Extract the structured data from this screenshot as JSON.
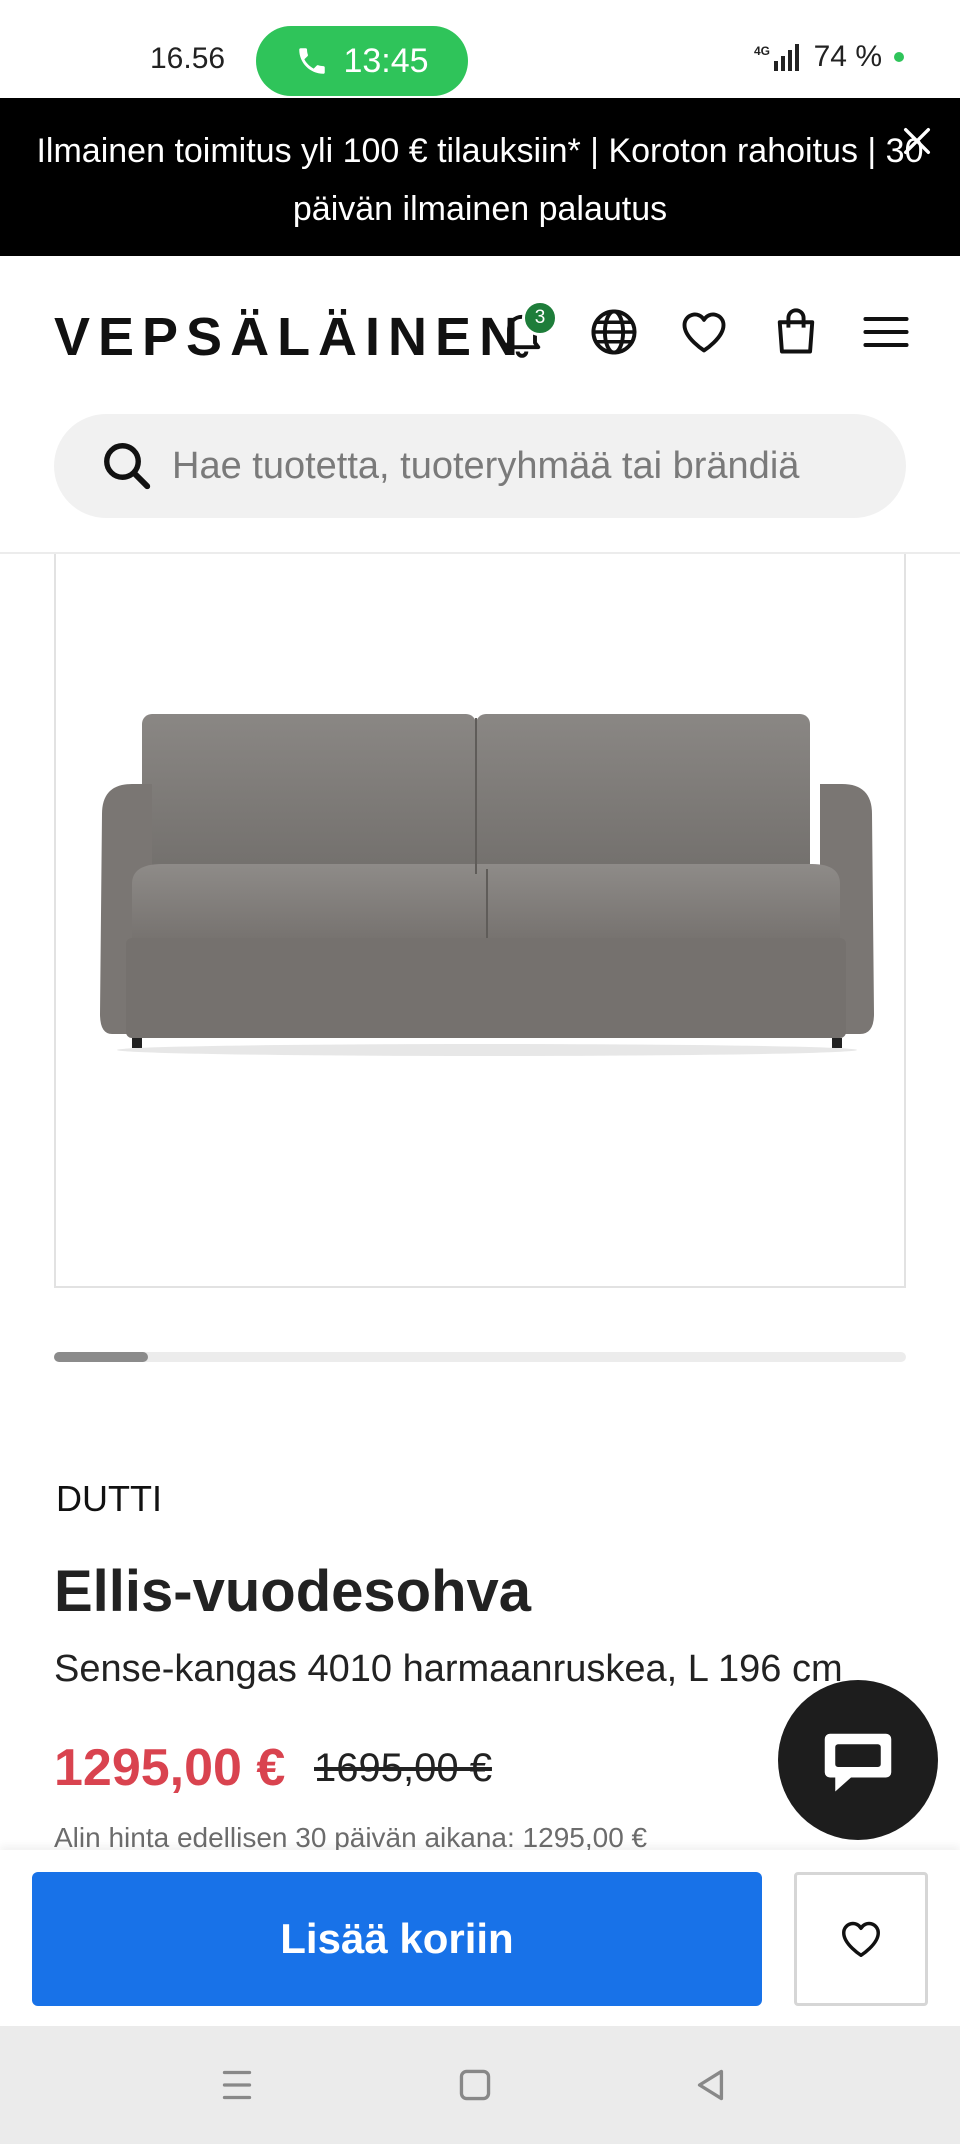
{
  "status_bar": {
    "time": "16.56",
    "call_timer": "13:45",
    "network": "4G",
    "battery": "74 %"
  },
  "promo": {
    "text": "Ilmainen toimitus yli 100 € tilauksiin* | Koroton rahoitus | 30 päivän ilmainen palautus"
  },
  "header": {
    "logo": "VEPSÄLÄINEN",
    "notification_count": "3",
    "icons": [
      "bell-icon",
      "globe-icon",
      "heart-icon",
      "shopping-bag-icon",
      "menu-icon"
    ]
  },
  "search": {
    "placeholder": "Hae tuotetta, tuoteryhmää tai brändiä"
  },
  "gallery": {
    "image_index": 1
  },
  "product": {
    "brand": "DUTTI",
    "title": "Ellis-vuodesohva",
    "subtitle": "Sense-kangas 4010 harmaanruskea, L 196 cm",
    "price": "1295,00 €",
    "old_price": "1695,00 €",
    "lowest_price_note": "Alin hinta edellisen 30 päivän aikana: 1295,00 €"
  },
  "actions": {
    "add_to_cart": "Lisää koriin"
  },
  "colors": {
    "promo_bg": "#000000",
    "price": "#d9434f",
    "primary_button": "#1872e8",
    "call_pill": "#2fc45a",
    "badge": "#1e7d3a"
  }
}
